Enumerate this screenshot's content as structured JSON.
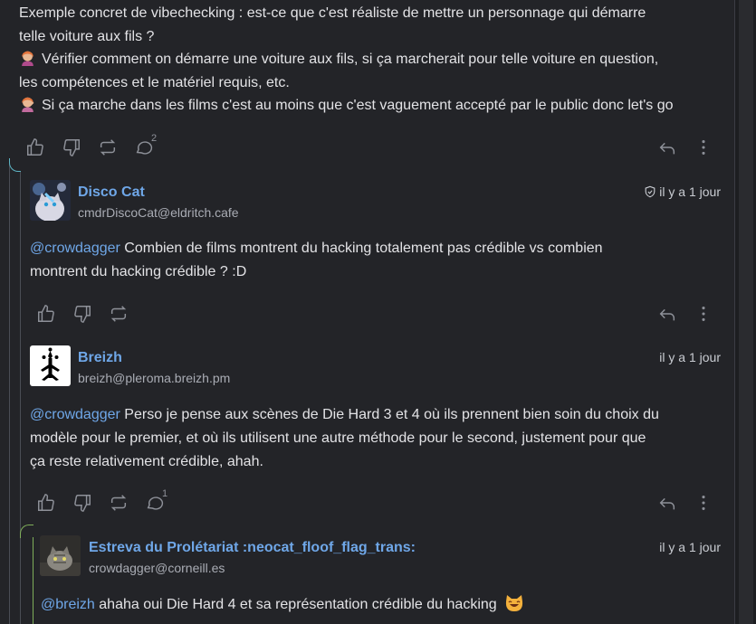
{
  "top_post": {
    "line1": "Exemple concret de vibechecking : est-ce que c'est réaliste de mettre un personnage qui démarre",
    "line2": "telle voiture aux fils ?",
    "line3": "Vérifier comment on démarre une voiture aux fils, si ça marcherait pour telle voiture en question,",
    "line4": "les compétences et le matériel requis, etc.",
    "line5": "Si ça marche dans les films c'est au moins que c'est vaguement accepté par le public donc let's go",
    "reply_count": "2",
    "emoji_icon": "person-emoji-icon"
  },
  "posts": [
    {
      "name": "Disco Cat",
      "handle": "cmdrDiscoCat@eldritch.cafe",
      "time": "il y a 1 jour",
      "mention": "@crowdagger",
      "text_line1": " Combien de films montrent du hacking totalement pas crédible vs combien",
      "text_line2": "montrent du hacking crédible ? :D",
      "avatar_icon": "cat-avatar-icon",
      "reply_count": ""
    },
    {
      "name": "Breizh",
      "handle": "breizh@pleroma.breizh.pm",
      "time": "il y a 1 jour",
      "mention": "@crowdagger",
      "text_line1": " Perso je pense aux scènes de Die Hard 3 et 4 où ils prennent bien soin du choix du",
      "text_line2": "modèle pour le premier, et où ils utilisent une autre méthode pour le second, justement pour que",
      "text_line3": "ça reste relativement crédible, ahah.",
      "avatar_icon": "ermine-avatar-icon",
      "reply_count": "1"
    },
    {
      "name": "Estreva du Prolétariat :neocat_floof_flag_trans:",
      "handle": "crowdagger@corneill.es",
      "time": "il y a 1 jour",
      "mention": "@breizh",
      "text_line1": " ahaha oui Die Hard 4 et sa représentation crédible du hacking",
      "avatar_icon": "cat-photo-avatar-icon",
      "emoji_icon": "grinning-cat-emoji-icon"
    }
  ],
  "colors": {
    "background": "#232428",
    "link": "#6fa7e8",
    "icon": "#8e9199",
    "thread_green": "#7fae5a"
  }
}
